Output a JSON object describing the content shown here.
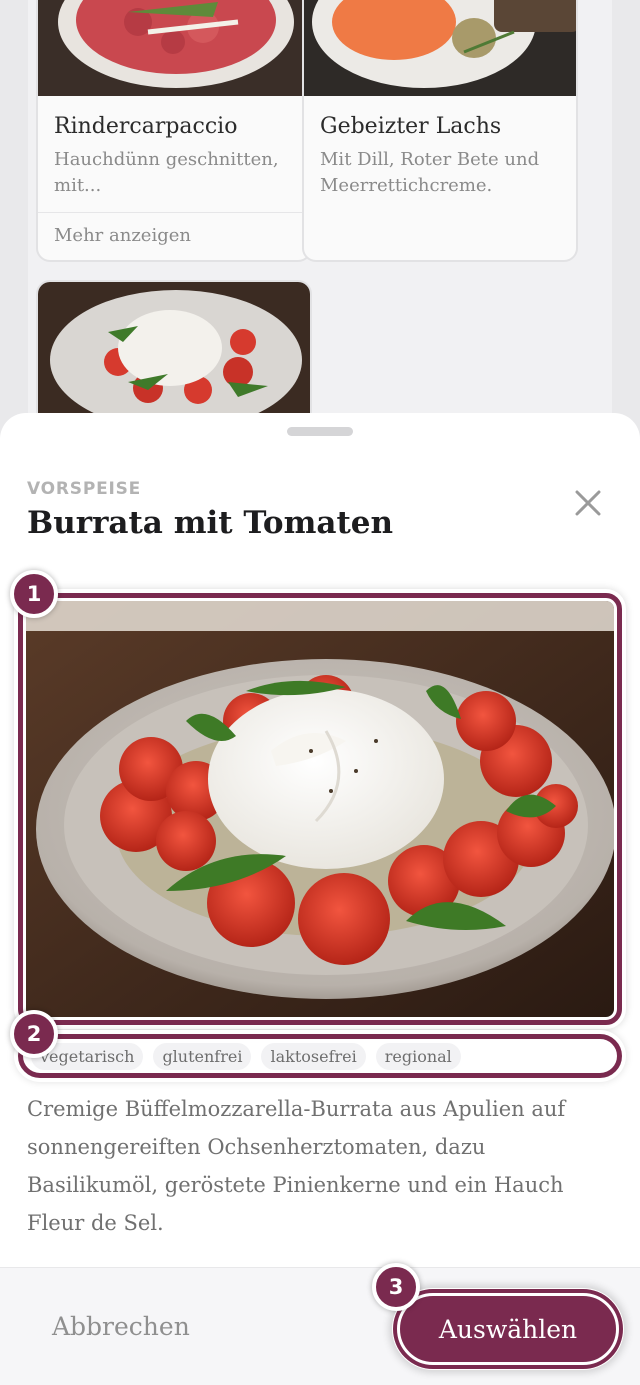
{
  "background_cards": [
    {
      "title": "Rindercarpaccio",
      "description": "Hauchdünn geschnitten, mit...",
      "more_label": "Mehr anzeigen"
    },
    {
      "title": "Gebeizter Lachs",
      "description": "Mit Dill, Roter Bete und Meerrettichcreme."
    }
  ],
  "sheet": {
    "category": "VORSPEISE",
    "title": "Burrata mit Tomaten",
    "close_icon": "close-icon",
    "tags": [
      "vegetarisch",
      "glutenfrei",
      "laktosefrei",
      "regional"
    ],
    "description": "Cremige Büffelmozzarella-Burrata aus Apulien auf sonnengereiften Ochsenherztomaten, dazu Basilikumöl, geröstete Pinienkerne und ein Hauch Fleur de Sel.",
    "cancel_label": "Abbrechen",
    "select_label": "Auswählen"
  },
  "markers": [
    "1",
    "2",
    "3"
  ],
  "colors": {
    "accent": "#7a2a4f",
    "sheet_bg": "#ffffff",
    "page_bg": "#e9e9eb"
  }
}
